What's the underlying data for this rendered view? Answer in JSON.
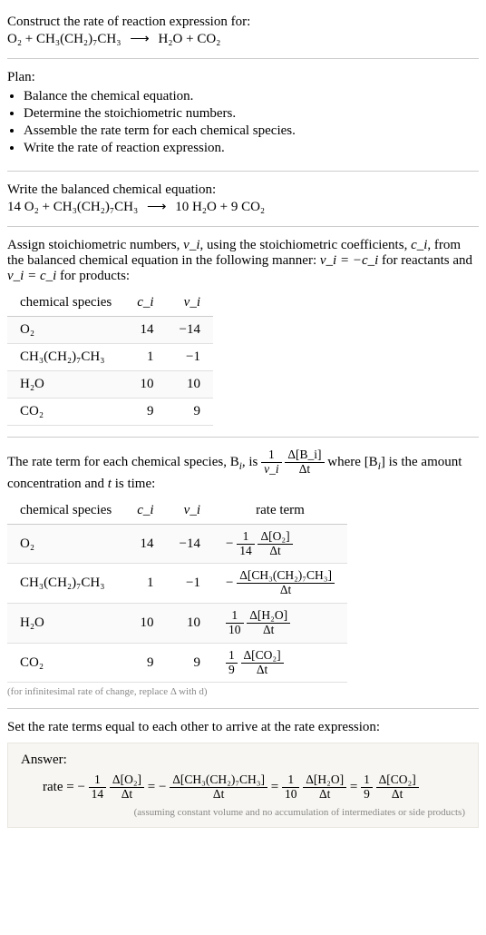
{
  "intro": {
    "prompt": "Construct the rate of reaction expression for:",
    "eq_lhs": "O₂ + CH₃(CH₂)₇CH₃",
    "eq_arrow": "⟶",
    "eq_rhs": "H₂O + CO₂"
  },
  "plan": {
    "heading": "Plan:",
    "items": [
      "Balance the chemical equation.",
      "Determine the stoichiometric numbers.",
      "Assemble the rate term for each chemical species.",
      "Write the rate of reaction expression."
    ]
  },
  "balanced": {
    "heading": "Write the balanced chemical equation:",
    "eq_lhs": "14 O₂ + CH₃(CH₂)₇CH₃",
    "eq_arrow": "⟶",
    "eq_rhs": "10 H₂O + 9 CO₂"
  },
  "stoich": {
    "text_a": "Assign stoichiometric numbers, ",
    "nu_i": "ν_i",
    "text_b": ", using the stoichiometric coefficients, ",
    "c_i": "c_i",
    "text_c": ", from the balanced chemical equation in the following manner: ",
    "rel1": "ν_i = −c_i",
    "text_d": " for reactants and ",
    "rel2": "ν_i = c_i",
    "text_e": " for products:",
    "headers": {
      "sp": "chemical species",
      "ci": "c_i",
      "nui": "ν_i"
    },
    "rows": [
      {
        "sp": "O₂",
        "ci": "14",
        "nui": "−14"
      },
      {
        "sp": "CH₃(CH₂)₇CH₃",
        "ci": "1",
        "nui": "−1"
      },
      {
        "sp": "H₂O",
        "ci": "10",
        "nui": "10"
      },
      {
        "sp": "CO₂",
        "ci": "9",
        "nui": "9"
      }
    ]
  },
  "rateterm": {
    "text_a": "The rate term for each chemical species, B",
    "text_b": ", is ",
    "one": "1",
    "nu_i": "ν_i",
    "dBi": "Δ[B_i]",
    "dt": "Δt",
    "text_c": " where [B",
    "text_d": "] is the amount concentration and ",
    "t": "t",
    "text_e": " is time:",
    "headers": {
      "sp": "chemical species",
      "ci": "c_i",
      "nui": "ν_i",
      "rt": "rate term"
    },
    "rows": [
      {
        "sp": "O₂",
        "ci": "14",
        "nui": "−14",
        "sign": "−",
        "pre_num": "1",
        "pre_den": "14",
        "num": "Δ[O₂]",
        "den": "Δt"
      },
      {
        "sp": "CH₃(CH₂)₇CH₃",
        "ci": "1",
        "nui": "−1",
        "sign": "−",
        "pre_num": "",
        "pre_den": "",
        "num": "Δ[CH₃(CH₂)₇CH₃]",
        "den": "Δt"
      },
      {
        "sp": "H₂O",
        "ci": "10",
        "nui": "10",
        "sign": "",
        "pre_num": "1",
        "pre_den": "10",
        "num": "Δ[H₂O]",
        "den": "Δt"
      },
      {
        "sp": "CO₂",
        "ci": "9",
        "nui": "9",
        "sign": "",
        "pre_num": "1",
        "pre_den": "9",
        "num": "Δ[CO₂]",
        "den": "Δt"
      }
    ],
    "footnote": "(for infinitesimal rate of change, replace Δ with d)"
  },
  "final": {
    "heading": "Set the rate terms equal to each other to arrive at the rate expression:",
    "answer_label": "Answer:",
    "rate_label": "rate = ",
    "terms": [
      {
        "sign": "−",
        "pre_num": "1",
        "pre_den": "14",
        "num": "Δ[O₂]",
        "den": "Δt"
      },
      {
        "sign": "−",
        "pre_num": "",
        "pre_den": "",
        "num": "Δ[CH₃(CH₂)₇CH₃]",
        "den": "Δt"
      },
      {
        "sign": "",
        "pre_num": "1",
        "pre_den": "10",
        "num": "Δ[H₂O]",
        "den": "Δt"
      },
      {
        "sign": "",
        "pre_num": "1",
        "pre_den": "9",
        "num": "Δ[CO₂]",
        "den": "Δt"
      }
    ],
    "eq_sep": " = ",
    "note": "(assuming constant volume and no accumulation of intermediates or side products)"
  },
  "chart_data": {
    "type": "table",
    "tables": [
      {
        "title": "stoichiometric numbers",
        "columns": [
          "chemical species",
          "c_i",
          "ν_i"
        ],
        "rows": [
          [
            "O₂",
            14,
            -14
          ],
          [
            "CH₃(CH₂)₇CH₃",
            1,
            -1
          ],
          [
            "H₂O",
            10,
            10
          ],
          [
            "CO₂",
            9,
            9
          ]
        ]
      },
      {
        "title": "rate terms",
        "columns": [
          "chemical species",
          "c_i",
          "ν_i",
          "rate term"
        ],
        "rows": [
          [
            "O₂",
            14,
            -14,
            "−(1/14)·Δ[O₂]/Δt"
          ],
          [
            "CH₃(CH₂)₇CH₃",
            1,
            -1,
            "−Δ[CH₃(CH₂)₇CH₃]/Δt"
          ],
          [
            "H₂O",
            10,
            10,
            "(1/10)·Δ[H₂O]/Δt"
          ],
          [
            "CO₂",
            9,
            9,
            "(1/9)·Δ[CO₂]/Δt"
          ]
        ]
      }
    ]
  }
}
